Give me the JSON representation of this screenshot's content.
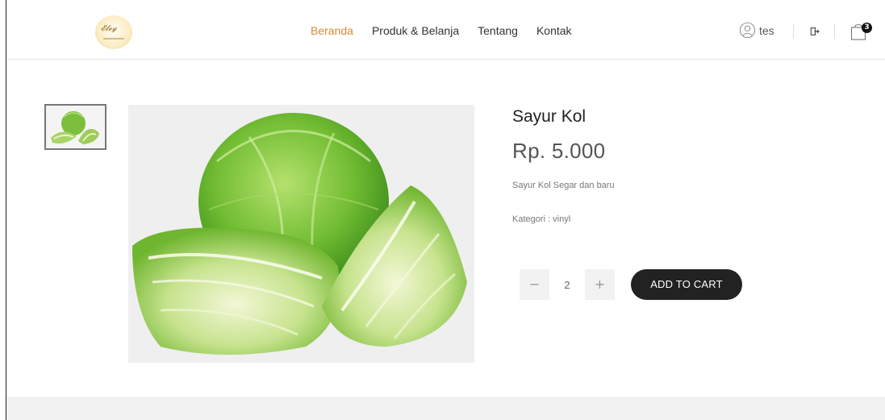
{
  "header": {
    "logo_name": "logo",
    "nav": [
      {
        "label": "Beranda",
        "active": true
      },
      {
        "label": "Produk & Belanja",
        "active": false
      },
      {
        "label": "Tentang",
        "active": false
      },
      {
        "label": "Kontak",
        "active": false
      }
    ],
    "user_name": "tes",
    "cart_count": "3"
  },
  "product": {
    "title": "Sayur Kol",
    "price": "Rp. 5.000",
    "description": "Sayur Kol Segar dan baru",
    "category_label": "Kategori : ",
    "category_value": "vinyl",
    "quantity": "2",
    "minus_label": "−",
    "plus_label": "+",
    "add_to_cart_label": "ADD TO CART"
  },
  "colors": {
    "accent_active_nav": "#d98a34",
    "button_dark": "#222222",
    "footer_band": "#f2f2f2"
  },
  "icons": {
    "user": "user-circle-icon",
    "logout": "logout-icon",
    "cart": "shopping-bag-icon"
  }
}
